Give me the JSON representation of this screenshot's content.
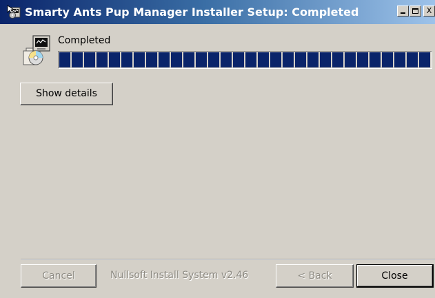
{
  "window": {
    "title": "Smarty Ants Pup Manager Installer Setup: Completed",
    "minimize_label": "_",
    "close_label": "X"
  },
  "status": {
    "label": "Completed",
    "progress": 1.0
  },
  "buttons": {
    "show_details": "Show details",
    "cancel": "Cancel",
    "back": "< Back",
    "close": "Close"
  },
  "branding": {
    "text": "Nullsoft Install System v2.46"
  },
  "colors": {
    "title_gradient_start": "#0a246a",
    "progress_fill": "#0a246a",
    "dialog_bg": "#d4d0c8"
  },
  "icons": {
    "title_icon": "installer-setup-icon",
    "header_icon": "installer-package-cd-icon"
  }
}
